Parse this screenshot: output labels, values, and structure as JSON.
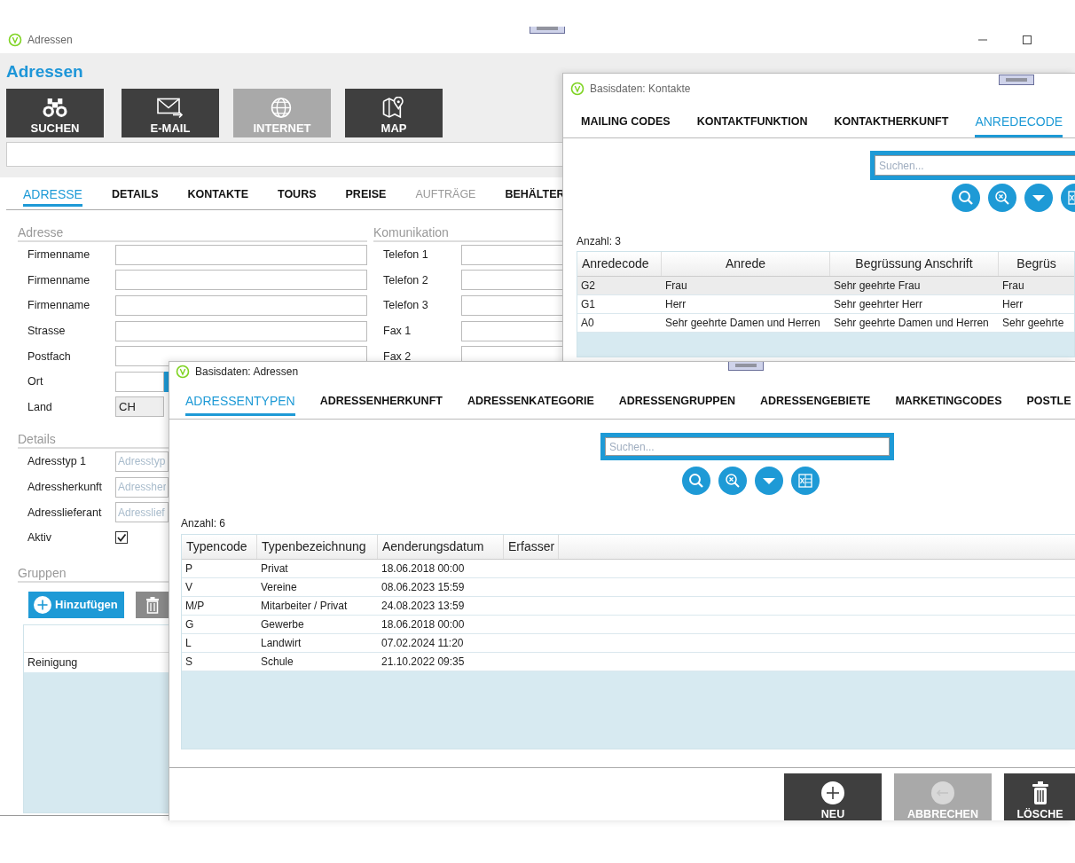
{
  "main_window": {
    "title": "Adressen",
    "heading": "Adressen",
    "toolbar": [
      {
        "label": "SUCHEN",
        "kind": "binoculars",
        "disabled": false
      },
      {
        "label": "E-MAIL",
        "kind": "mail",
        "disabled": false
      },
      {
        "label": "INTERNET",
        "kind": "globe",
        "disabled": true
      },
      {
        "label": "MAP",
        "kind": "map",
        "disabled": false
      }
    ],
    "tabs": [
      {
        "label": "ADRESSE",
        "selected": true,
        "disabled": false
      },
      {
        "label": "DETAILS",
        "selected": false,
        "disabled": false
      },
      {
        "label": "KONTAKTE",
        "selected": false,
        "disabled": false
      },
      {
        "label": "TOURS",
        "selected": false,
        "disabled": false
      },
      {
        "label": "PREISE",
        "selected": false,
        "disabled": false
      },
      {
        "label": "AUFTRÄGE",
        "selected": false,
        "disabled": true
      },
      {
        "label": "BEHÄLTER",
        "selected": false,
        "disabled": false
      }
    ],
    "address_section": {
      "title": "Adresse",
      "fields": [
        {
          "label": "Firmenname",
          "kind": "text"
        },
        {
          "label": "Firmenname",
          "kind": "text"
        },
        {
          "label": "Firmenname",
          "kind": "text"
        },
        {
          "label": "Strasse",
          "kind": "text"
        },
        {
          "label": "Postfach",
          "kind": "text"
        },
        {
          "label": "Ort",
          "kind": "lookup"
        },
        {
          "label": "Land",
          "kind": "readonly",
          "value": "CH"
        }
      ]
    },
    "communication_section": {
      "title": "Komunikation",
      "fields": [
        {
          "label": "Telefon 1"
        },
        {
          "label": "Telefon 2"
        },
        {
          "label": "Telefon 3"
        },
        {
          "label": "Fax 1"
        },
        {
          "label": "Fax 2"
        }
      ]
    },
    "details_section": {
      "title": "Details",
      "fields": [
        {
          "label": "Adresstyp 1",
          "kind": "combo",
          "placeholder": "Adresstyp"
        },
        {
          "label": "Adressherkunft",
          "kind": "combo",
          "placeholder": "Adressher"
        },
        {
          "label": "Adresslieferant",
          "kind": "combo",
          "placeholder": "Adresslief"
        },
        {
          "label": "Aktiv",
          "kind": "checkbox",
          "checked": true
        }
      ]
    },
    "groups_section": {
      "title": "Gruppen",
      "add_button": "Hinzufügen",
      "rows": [
        "Reinigung"
      ]
    }
  },
  "contacts_window": {
    "title": "Basisdaten: Kontakte",
    "tabs": [
      {
        "label": "MAILING CODES",
        "selected": false
      },
      {
        "label": "KONTAKTFUNKTION",
        "selected": false
      },
      {
        "label": "KONTAKTHERKUNFT",
        "selected": false
      },
      {
        "label": "ANREDECODE",
        "selected": true
      }
    ],
    "search": {
      "placeholder": "Suchen..."
    },
    "count": "Anzahl: 3",
    "table": {
      "columns": [
        "Anredecode",
        "Anrede",
        "Begrüssung Anschrift",
        "Begrüs"
      ],
      "rows": [
        {
          "cells": [
            "G2",
            "Frau",
            "Sehr geehrte Frau",
            "Frau"
          ],
          "selected": true
        },
        {
          "cells": [
            "G1",
            "Herr",
            "Sehr geehrter Herr",
            "Herr"
          ],
          "selected": false
        },
        {
          "cells": [
            "A0",
            "Sehr geehrte Damen und Herren",
            "Sehr geehrte Damen und Herren",
            "Sehr geehrte"
          ],
          "selected": false
        }
      ]
    }
  },
  "addresses_window": {
    "title": "Basisdaten: Adressen",
    "tabs": [
      {
        "label": "ADRESSENTYPEN",
        "selected": true
      },
      {
        "label": "ADRESSENHERKUNFT",
        "selected": false
      },
      {
        "label": "ADRESSENKATEGORIE",
        "selected": false
      },
      {
        "label": "ADRESSENGRUPPEN",
        "selected": false
      },
      {
        "label": "ADRESSENGEBIETE",
        "selected": false
      },
      {
        "label": "MARKETINGCODES",
        "selected": false
      },
      {
        "label": "POSTLE",
        "selected": false
      }
    ],
    "search": {
      "placeholder": "Suchen..."
    },
    "count": "Anzahl: 6",
    "table": {
      "columns": [
        "Typencode",
        "Typenbezeichnung",
        "Aenderungsdatum",
        "Erfasser"
      ],
      "rows": [
        {
          "cells": [
            "P",
            "Privat",
            "18.06.2018 00:00"
          ],
          "selected": false
        },
        {
          "cells": [
            "V",
            "Vereine",
            "08.06.2023 15:59"
          ],
          "selected": false
        },
        {
          "cells": [
            "M/P",
            "Mitarbeiter / Privat",
            "24.08.2023 13:59"
          ],
          "selected": false
        },
        {
          "cells": [
            "G",
            "Gewerbe",
            "18.06.2018 00:00"
          ],
          "selected": false
        },
        {
          "cells": [
            "L",
            "Landwirt",
            "07.02.2024 11:20"
          ],
          "selected": false
        },
        {
          "cells": [
            "S",
            "Schule",
            "21.10.2022 09:35"
          ],
          "selected": false
        }
      ]
    },
    "buttons": [
      {
        "label": "NEU",
        "kind": "add",
        "disabled": false
      },
      {
        "label": "ABBRECHEN",
        "kind": "cancel",
        "disabled": true
      },
      {
        "label": "LÖSCHE",
        "kind": "delete",
        "disabled": false
      }
    ]
  }
}
